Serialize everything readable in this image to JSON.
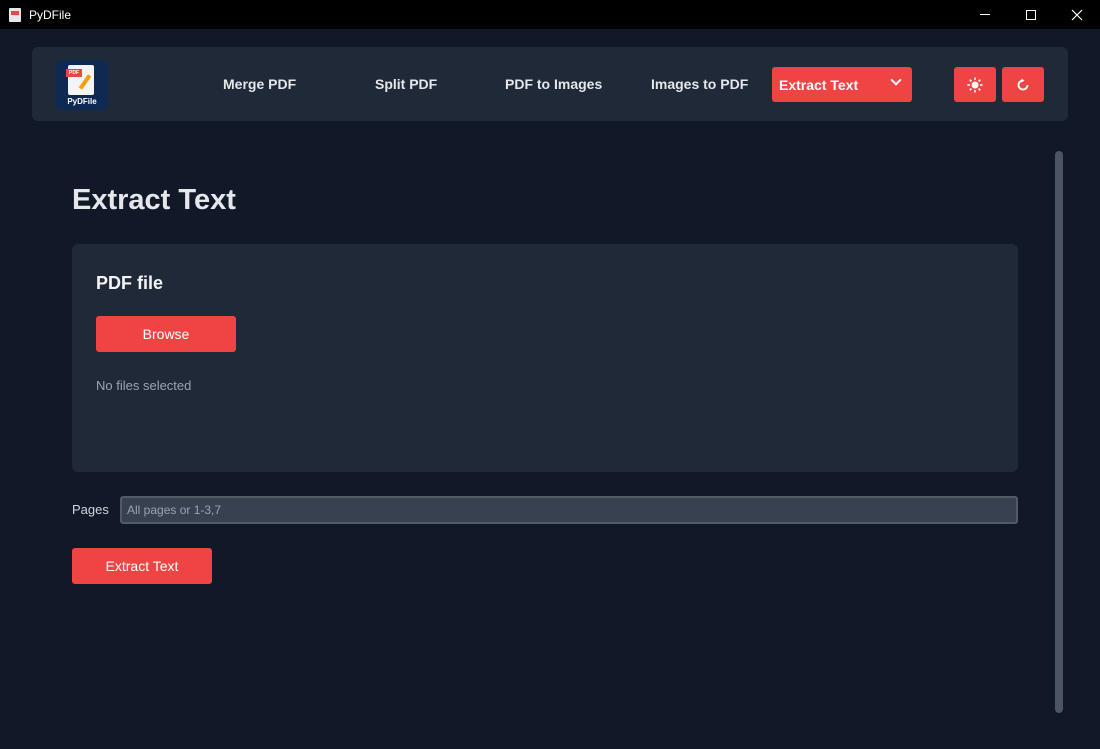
{
  "window": {
    "title": "PyDFile",
    "controls": [
      "minimize",
      "maximize",
      "close"
    ]
  },
  "nav": {
    "logo_text": "PyDFile",
    "logo_badge": "PDF",
    "items": [
      {
        "label": "Merge PDF"
      },
      {
        "label": "Split PDF"
      },
      {
        "label": "PDF to Images"
      },
      {
        "label": "Images to PDF"
      }
    ],
    "select_value": "Extract Text",
    "theme_icon": "sun-icon",
    "reset_icon": "refresh-icon"
  },
  "main": {
    "title": "Extract Text",
    "card": {
      "title": "PDF file",
      "browse_label": "Browse",
      "status": "No files selected"
    },
    "pages": {
      "label": "Pages",
      "placeholder": "All pages or 1-3,7",
      "value": ""
    },
    "action_label": "Extract Text"
  },
  "colors": {
    "accent": "#ef4444",
    "background": "#111827",
    "panel": "#1f2937"
  }
}
